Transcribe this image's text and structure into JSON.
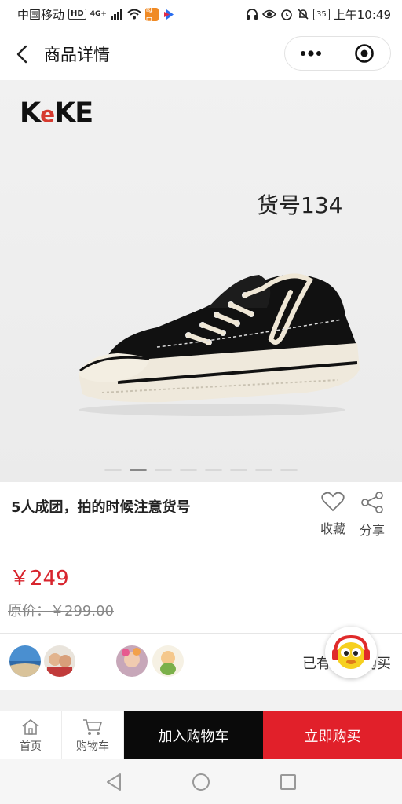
{
  "status_bar": {
    "carrier": "中国移动",
    "hd_badge": "HD",
    "network": "4G+",
    "app_badge_1": "每日",
    "battery": "35",
    "time": "上午10:49",
    "icons": [
      "signal-icon",
      "wifi-icon",
      "headset-icon",
      "eye-icon",
      "alarm-icon",
      "mute-icon",
      "battery-icon"
    ]
  },
  "navbar": {
    "title": "商品详情",
    "back_icon": "chevron-left-icon",
    "more_icon": "more-dots-icon",
    "close_icon": "target-icon"
  },
  "gallery": {
    "brand": {
      "k": "K",
      "e": "e",
      "rest": "KE"
    },
    "item_code": "货号134",
    "image_count": 8,
    "active_index": 1
  },
  "product": {
    "title": "5人成团，拍的时候注意货号",
    "price": "￥249",
    "original_price": "原价：￥299.00",
    "favorite_label": "收藏",
    "share_label": "分享"
  },
  "group_buy": {
    "text": "已有15人购买"
  },
  "bottom_bar": {
    "home_label": "首页",
    "cart_label": "购物车",
    "add_to_cart": "加入购物车",
    "buy_now": "立即购买"
  },
  "colors": {
    "accent_red": "#e1202a",
    "price_red": "#d8252e",
    "cart_black": "#0a0a0a"
  }
}
